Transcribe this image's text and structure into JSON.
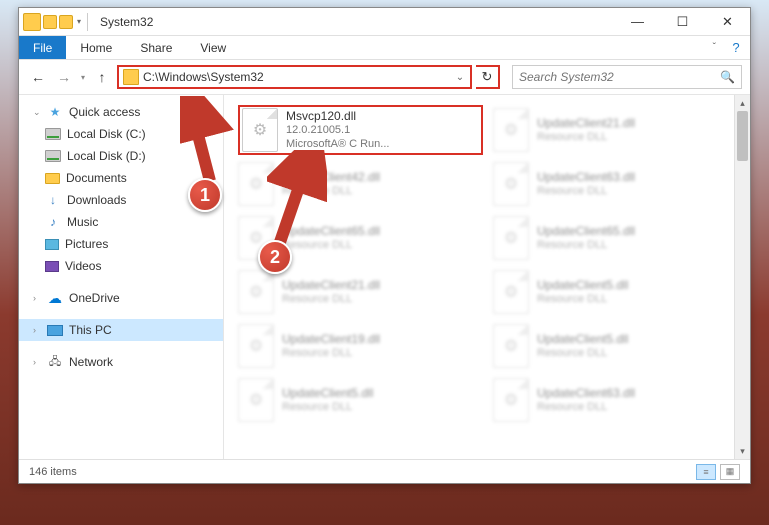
{
  "window": {
    "title": "System32"
  },
  "ribbon": {
    "file": "File",
    "home": "Home",
    "share": "Share",
    "view": "View"
  },
  "address": {
    "path": "C:\\Windows\\System32"
  },
  "search": {
    "placeholder": "Search System32"
  },
  "sidebar": {
    "quick_access": "Quick access",
    "items": [
      {
        "label": "Local Disk (C:)"
      },
      {
        "label": "Local Disk (D:)"
      },
      {
        "label": "Documents"
      },
      {
        "label": "Downloads"
      },
      {
        "label": "Music"
      },
      {
        "label": "Pictures"
      },
      {
        "label": "Videos"
      }
    ],
    "onedrive": "OneDrive",
    "thispc": "This PC",
    "network": "Network"
  },
  "files": {
    "focus": {
      "name": "Msvcp120.dll",
      "line2": "12.0.21005.1",
      "line3": "MicrosoftA® C Run..."
    },
    "blurred": [
      {
        "name": "UpdateClient21.dll",
        "sub": "Resource DLL"
      },
      {
        "name": "UpdateClient42.dll",
        "sub": "Resource DLL"
      },
      {
        "name": "UpdateClient63.dll",
        "sub": "Resource DLL"
      },
      {
        "name": "UpdateClient65.dll",
        "sub": "Resource DLL"
      },
      {
        "name": "UpdateClient65.dll",
        "sub": "Resource DLL"
      },
      {
        "name": "UpdateClient21.dll",
        "sub": "Resource DLL"
      },
      {
        "name": "UpdateClient5.dll",
        "sub": "Resource DLL"
      },
      {
        "name": "UpdateClient19.dll",
        "sub": "Resource DLL"
      },
      {
        "name": "UpdateClient5.dll",
        "sub": "Resource DLL"
      },
      {
        "name": "UpdateClient5.dll",
        "sub": "Resource DLL"
      },
      {
        "name": "UpdateClient63.dll",
        "sub": "Resource DLL"
      }
    ]
  },
  "status": {
    "count": "146 items"
  },
  "annotations": {
    "b1": "1",
    "b2": "2"
  }
}
